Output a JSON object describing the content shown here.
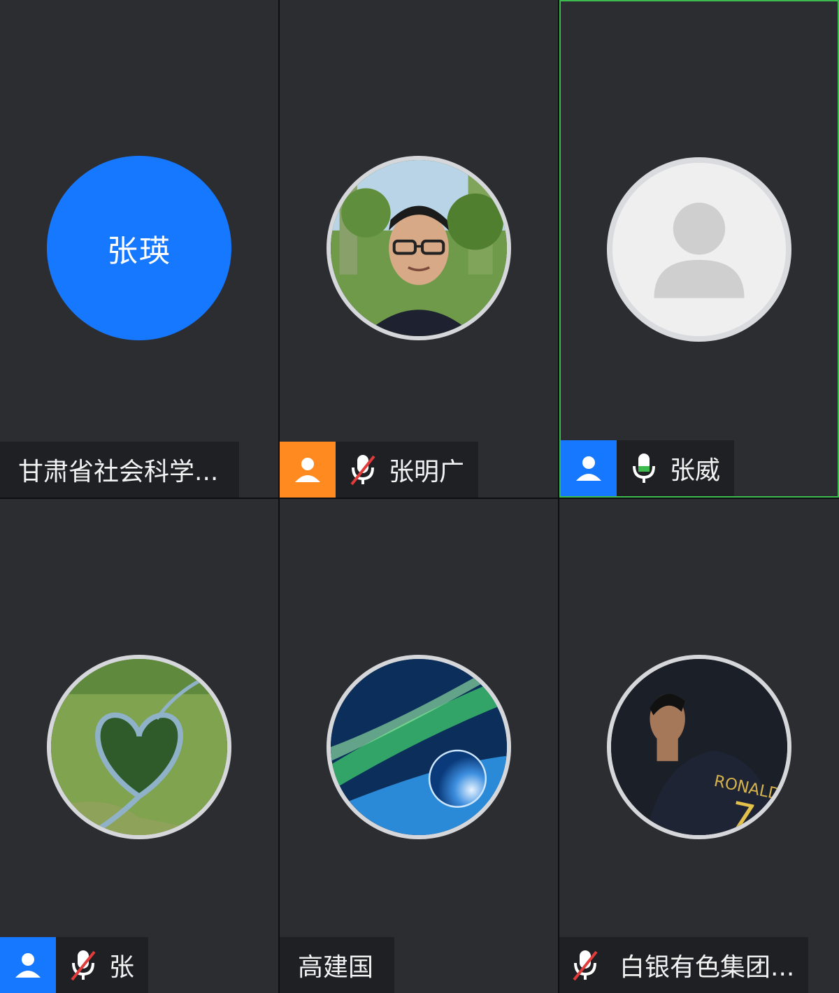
{
  "participants": [
    {
      "avatar_text": "张瑛",
      "name": "甘肃省社会科学...",
      "role_badge": null,
      "mic": null,
      "highlighted": false
    },
    {
      "avatar_text": "",
      "name": "张明广",
      "role_badge": "orange",
      "mic": "muted",
      "highlighted": false
    },
    {
      "avatar_text": "",
      "name": "张威",
      "role_badge": "blue",
      "mic": "active",
      "highlighted": true
    },
    {
      "avatar_text": "",
      "name": "张",
      "role_badge": "blue",
      "mic": "muted",
      "highlighted": false
    },
    {
      "avatar_text": "",
      "name": "高建国",
      "role_badge": null,
      "mic": null,
      "highlighted": false
    },
    {
      "avatar_text": "",
      "name": "白银有色集团...",
      "role_badge": null,
      "mic": "muted",
      "highlighted": false
    }
  ],
  "colors": {
    "tile_bg": "#2b2d31",
    "highlight": "#3dbb4f",
    "host_badge": "#ff8a1f",
    "cohost_badge": "#1677ff",
    "avatar_blue": "#1677ff"
  },
  "icons": {
    "role": "person-icon",
    "mic_muted": "mic-muted-icon",
    "mic_active": "mic-icon",
    "placeholder": "default-avatar-icon"
  }
}
